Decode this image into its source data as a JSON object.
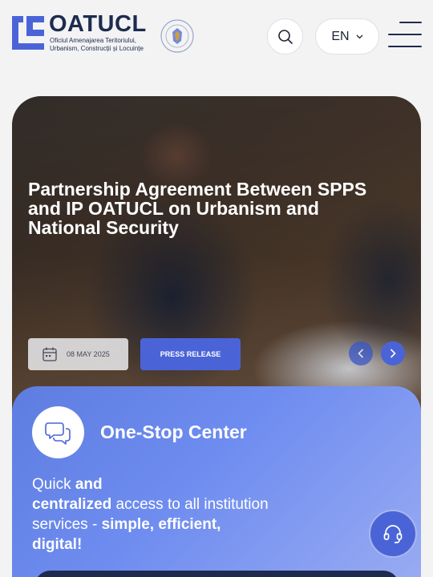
{
  "header": {
    "logo_name": "OATUCL",
    "logo_subtitle": "Oficiul Amenajarea Teritoriului, Urbanism, Construcții și Locuințe",
    "language": "EN",
    "icons": {
      "search": "search-icon",
      "language_chevron": "chevron-down-icon",
      "menu": "hamburger-menu-icon"
    }
  },
  "hero": {
    "title": "Partnership Agreement Between SPPS and IP OATUCL on Urbanism and National Security",
    "date": "08 MAY 2025",
    "tag": "PRESS RELEASE",
    "icons": {
      "date": "calendar-icon",
      "prev": "chevron-left-icon",
      "next": "chevron-right-icon"
    }
  },
  "one_stop": {
    "title": "One-Stop Center",
    "text_1": "Quick ",
    "text_2": "and",
    "text_3": "centralized",
    "text_4": " access to all institution services - ",
    "text_5": "simple, efficient, digital!",
    "icon": "chat-bubbles-icon"
  },
  "support": {
    "icon": "headset-icon"
  },
  "colors": {
    "primary": "#4a64d8",
    "navy": "#1e2b4f",
    "background": "#f3f3f4"
  }
}
